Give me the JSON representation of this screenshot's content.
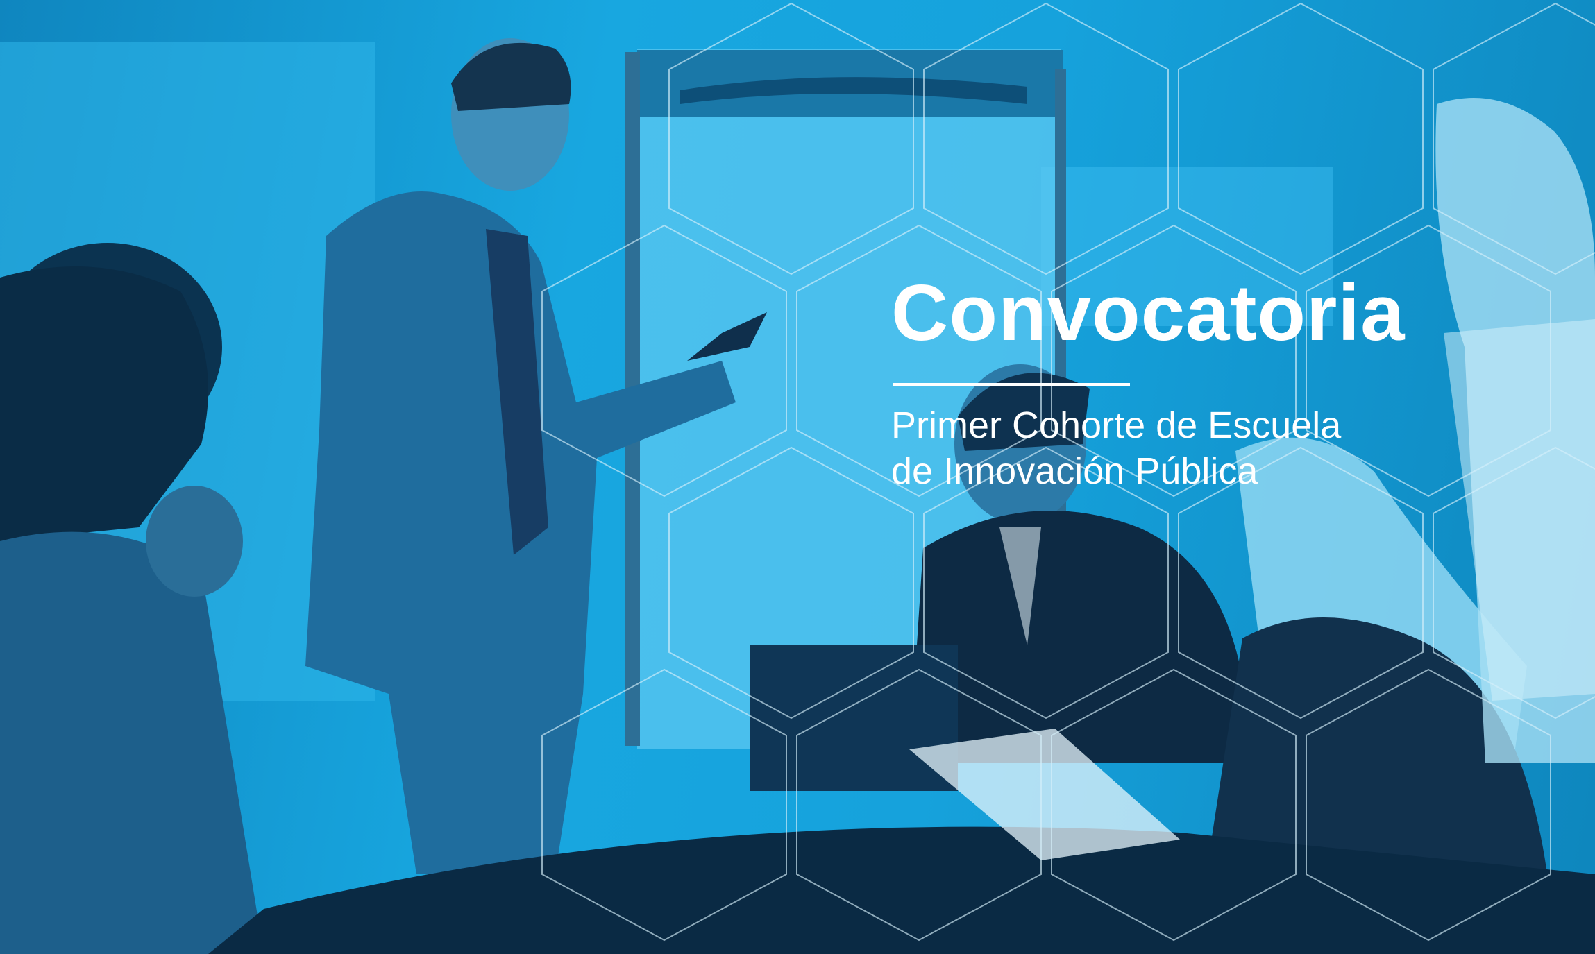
{
  "banner": {
    "title": "Convocatoria",
    "subtitle_line1": "Primer Cohorte de Escuela",
    "subtitle_line2": "de Innovación Pública"
  },
  "colors": {
    "background": "#1aa3dc",
    "overlay": "#0f86bf",
    "text": "#ffffff",
    "hex_line": "#bfe6f7"
  },
  "photo": {
    "description_icons": [
      "presenter-figure",
      "flipchart",
      "seated-attendees",
      "meeting-table",
      "laptop",
      "papers"
    ]
  }
}
